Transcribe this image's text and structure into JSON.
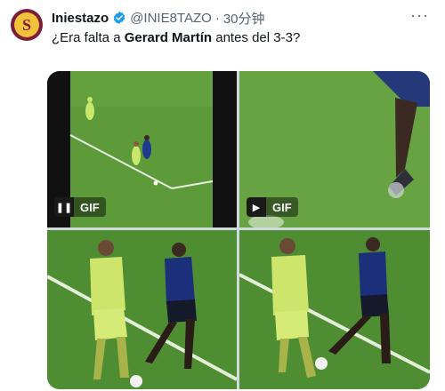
{
  "author": {
    "name": "Iniestazo",
    "handle": "@INIE8TAZO",
    "separator": "·",
    "time": "30分钟",
    "avatar_letter": "S",
    "avatar_color": "#7a1e3a",
    "avatar_accent": "#f2c23c",
    "verified_color": "#1d9bf0"
  },
  "tweet": {
    "text_before": "¿Era falta a ",
    "text_bold": "Gerard Martín",
    "text_after": " antes del 3-3?"
  },
  "more_label": "···",
  "media": [
    {
      "id": "clip-1",
      "gif_label": "GIF",
      "control": "pause-icon",
      "control_glyph": "❚❚"
    },
    {
      "id": "clip-2",
      "gif_label": "GIF",
      "control": "play-icon",
      "control_glyph": "▶"
    },
    {
      "id": "clip-3"
    },
    {
      "id": "clip-4"
    }
  ]
}
